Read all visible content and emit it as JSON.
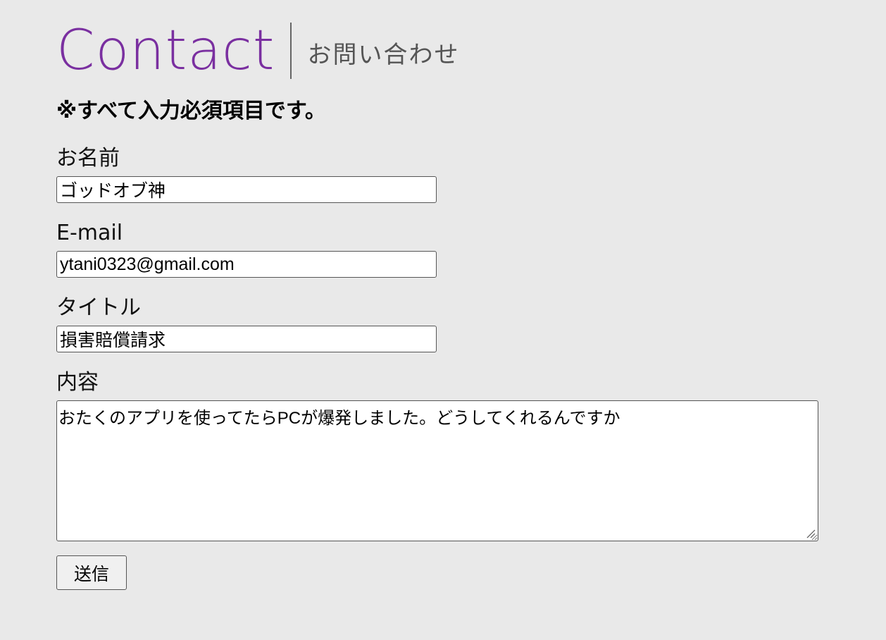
{
  "heading": {
    "title_en": "Contact",
    "title_jp": "お問い合わせ"
  },
  "required_note": "※すべて入力必須項目です。",
  "form": {
    "name": {
      "label": "お名前",
      "value": "ゴッドオブ神"
    },
    "email": {
      "label": "E-mail",
      "value": "ytani0323@gmail.com"
    },
    "title": {
      "label": "タイトル",
      "value": "損害賠償請求"
    },
    "content": {
      "label": "内容",
      "value": "おたくのアプリを使ってたらPCが爆発しました。どうしてくれるんですか"
    },
    "submit_label": "送信"
  },
  "colors": {
    "accent": "#7a2fa0",
    "background": "#e9e9e9"
  }
}
